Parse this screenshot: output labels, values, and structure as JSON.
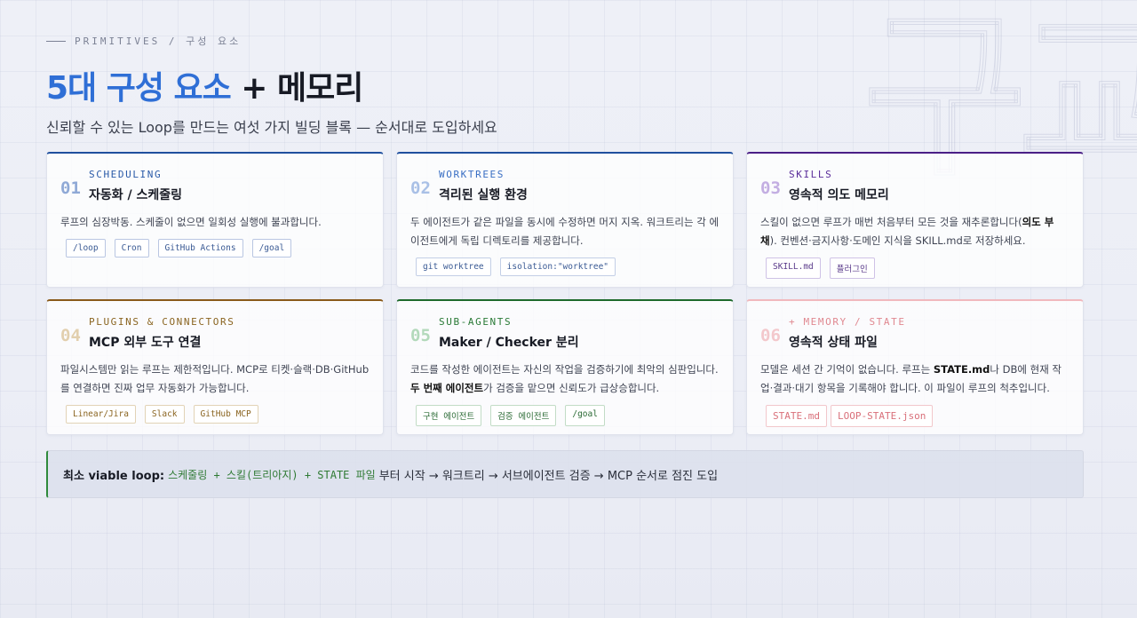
{
  "watermark": "구교",
  "eyebrow": "PRIMITIVES / 구성 요소",
  "title": {
    "accent": "5대 구성 요소",
    "rest": " + 메모리"
  },
  "subtitle": "신뢰할 수 있는 Loop를 만드는 여섯 가지 빌딩 블록 — 순서대로 도입하세요",
  "cards": [
    {
      "num": "01",
      "kicker": "SCHEDULING",
      "title": "자동화 / 스케줄링",
      "desc_parts": [
        "루프의 심장박동. 스케줄이 없으면 일회성 실행에 불과합니다.",
        "",
        ""
      ],
      "tags": [
        "/loop",
        "Cron",
        "GitHub Actions",
        "/goal"
      ],
      "colors": {
        "top": "#1f4f9e",
        "num": "#8fa9d6",
        "kick": "#2a5aa8",
        "tagb": "#b9c6e2",
        "tagc": "#3a5a94"
      }
    },
    {
      "num": "02",
      "kicker": "WORKTREES",
      "title": "격리된 실행 환경",
      "desc_parts": [
        "두 에이전트가 같은 파일을 동시에 수정하면 머지 지옥. 워크트리는 각 에이전트에게 독립 디렉토리를 제공합니다.",
        "",
        ""
      ],
      "tags": [
        "git worktree",
        "isolation:\"worktree\""
      ],
      "colors": {
        "top": "#1f4f9e",
        "num": "#a9c0e6",
        "kick": "#3a6fc4",
        "tagb": "#c3cfe6",
        "tagc": "#3a5a94"
      }
    },
    {
      "num": "03",
      "kicker": "SKILLS",
      "title": "영속적 의도 메모리",
      "desc_parts": [
        "스킬이 없으면 루프가 매번 처음부터 모든 것을 재추론합니다(",
        "의도 부채",
        "). 컨벤션·금지사항·도메인 지식을 SKILL.md로 저장하세요."
      ],
      "tags": [
        "SKILL.md",
        "플러그인"
      ],
      "colors": {
        "top": "#4a1f86",
        "num": "#c3aee2",
        "kick": "#5a2d9a",
        "tagb": "#cfc2e6",
        "tagc": "#5a3a8a"
      }
    },
    {
      "num": "04",
      "kicker": "PLUGINS & CONNECTORS",
      "title": "MCP 외부 도구 연결",
      "desc_parts": [
        "파일시스템만 읽는 루프는 제한적입니다. MCP로 티켓·슬랙·DB·GitHub를 연결하면 진짜 업무 자동화가 가능합니다.",
        "",
        ""
      ],
      "tags": [
        "Linear/Jira",
        "Slack",
        "GitHub MCP"
      ],
      "colors": {
        "top": "#8a5a1a",
        "num": "#e2cfae",
        "kick": "#8a6420",
        "tagb": "#e2d3b6",
        "tagc": "#8a6420"
      }
    },
    {
      "num": "05",
      "kicker": "SUB-AGENTS",
      "title": "Maker / Checker 분리",
      "desc_parts": [
        "코드를 작성한 에이전트는 자신의 작업을 검증하기에 최악의 심판입니다. ",
        "두 번째 에이전트",
        "가 검증을 맡으면 신뢰도가 급상승합니다."
      ],
      "tags": [
        "구현 에이전트",
        "검증 에이전트",
        "/goal"
      ],
      "colors": {
        "top": "#1e6a2c",
        "num": "#b3d9bb",
        "kick": "#2a7a36",
        "tagb": "#c2dcc6",
        "tagc": "#2a6a34"
      }
    },
    {
      "num": "06",
      "kicker": "+ MEMORY / STATE",
      "title": "영속적 상태 파일",
      "desc_parts": [
        "모델은 세션 간 기억이 없습니다. 루프는 ",
        "STATE.md",
        "나 DB에 현재 작업·결과·대기 항목을 기록해야 합니다. 이 파일이 루프의 척추입니다."
      ],
      "tags": [
        "STATE.md",
        "LOOP-STATE.json"
      ],
      "colors": {
        "top": "#f1b8bd",
        "num": "#f3c8cc",
        "kick": "#e08890",
        "tagb": "#f2c7cb",
        "tagc": "#d9707a"
      }
    }
  ],
  "banner": {
    "lead": "최소 viable loop:",
    "highlight": "스케줄링 + 스킬(트리아지) + STATE 파일",
    "rest": "부터 시작 → 워크트리 → 서브에이전트 검증 → MCP 순서로 점진 도입"
  }
}
